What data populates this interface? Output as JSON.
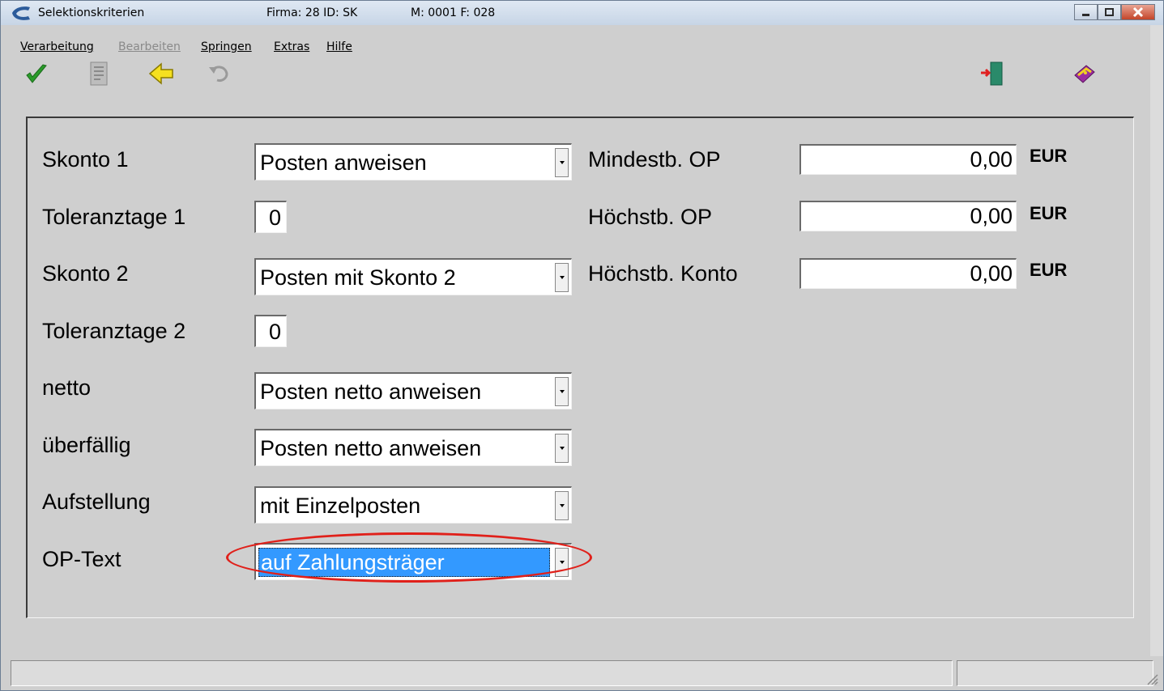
{
  "window": {
    "title": "Selektionskriterien",
    "firma": "Firma: 28 ID: SK",
    "meta": "M: 0001 F: 028"
  },
  "menu": {
    "items": [
      {
        "label": "Verarbeitung",
        "enabled": true
      },
      {
        "label": "Bearbeiten",
        "enabled": false
      },
      {
        "label": "Springen",
        "enabled": true
      },
      {
        "label": "Extras",
        "enabled": true
      },
      {
        "label": "Hilfe",
        "enabled": true
      }
    ]
  },
  "toolbar": {
    "icons": [
      "checkmark-icon",
      "document-icon",
      "back-arrow-icon",
      "undo-icon",
      "exit-door-icon",
      "help-book-icon"
    ]
  },
  "form": {
    "skonto1": {
      "label": "Skonto 1",
      "value": "Posten anweisen"
    },
    "toleranz1": {
      "label": "Toleranztage 1",
      "value": "0"
    },
    "skonto2": {
      "label": "Skonto 2",
      "value": "Posten mit Skonto 2"
    },
    "toleranz2": {
      "label": "Toleranztage 2",
      "value": "0"
    },
    "netto": {
      "label": "netto",
      "value": "Posten netto anweisen"
    },
    "ueberfaellig": {
      "label": "überfällig",
      "value": "Posten netto anweisen"
    },
    "aufstellung": {
      "label": "Aufstellung",
      "value": "mit Einzelposten"
    },
    "optext": {
      "label": "OP-Text",
      "value": "auf Zahlungsträger"
    },
    "mindest_op": {
      "label": "Mindestb. OP",
      "value": "0,00",
      "currency": "EUR"
    },
    "hoechst_op": {
      "label": "Höchstb. OP",
      "value": "0,00",
      "currency": "EUR"
    },
    "hoechst_konto": {
      "label": "Höchstb. Konto",
      "value": "0,00",
      "currency": "EUR"
    }
  },
  "colors": {
    "selection": "#3399ff",
    "highlight": "#e0201a",
    "background": "#cfcfcf"
  }
}
